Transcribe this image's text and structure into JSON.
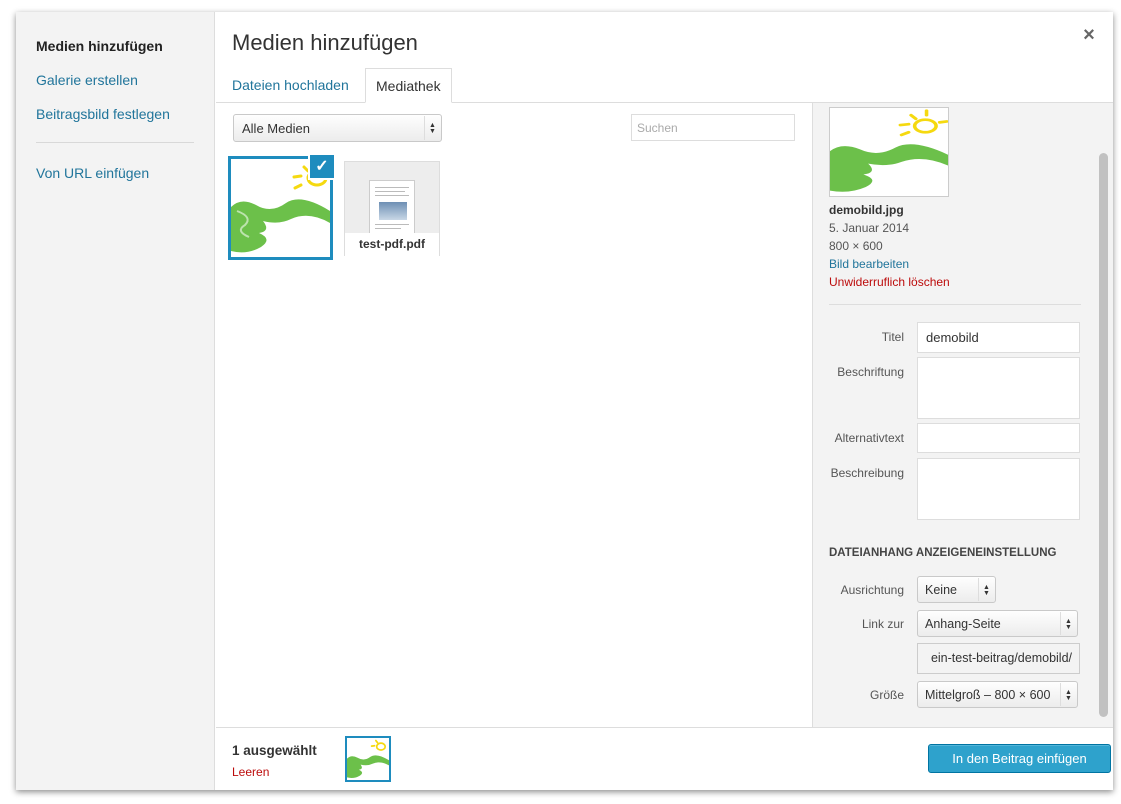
{
  "menu": {
    "items": [
      "Medien hinzufügen",
      "Galerie erstellen",
      "Beitragsbild festlegen",
      "Von URL einfügen"
    ]
  },
  "title": "Medien hinzufügen",
  "close_symbol": "×",
  "tabs": [
    "Dateien hochladen",
    "Mediathek"
  ],
  "toolbar": {
    "filter_value": "Alle Medien",
    "search_placeholder": "Suchen"
  },
  "attachments": [
    {
      "name": "demobild.jpg",
      "selected": true
    },
    {
      "name": "test-pdf.pdf",
      "selected": false
    }
  ],
  "details": {
    "filename": "demobild.jpg",
    "date": "5. Januar 2014",
    "dimensions": "800 × 600",
    "edit_link": "Bild bearbeiten",
    "delete_link": "Unwiderruflich löschen"
  },
  "fields": {
    "title_label": "Titel",
    "title_value": "demobild",
    "caption_label": "Beschriftung",
    "alt_label": "Alternativtext",
    "description_label": "Beschreibung"
  },
  "display_settings": {
    "heading": "DATEIANHANG ANZEIGENEINSTELLUNG",
    "align_label": "Ausrichtung",
    "align_value": "Keine",
    "link_label": "Link zur",
    "link_value": "Anhang-Seite",
    "link_url": "ein-test-beitrag/demobild/",
    "size_label": "Größe",
    "size_value": "Mittelgroß – 800 × 600"
  },
  "footer": {
    "selection_count": "1 ausgewählt",
    "clear_label": "Leeren",
    "insert_button": "In den Beitrag einfügen"
  },
  "colors": {
    "accent": "#1e8cbe",
    "link": "#21759b",
    "danger": "#bc0b0b",
    "button": "#2ea2cc",
    "image_green": "#6cc04a",
    "image_yellow": "#f5d90f"
  },
  "icons": {
    "check": "checkmark-icon",
    "close": "close-icon",
    "select_arrows": "select-arrows-icon"
  }
}
